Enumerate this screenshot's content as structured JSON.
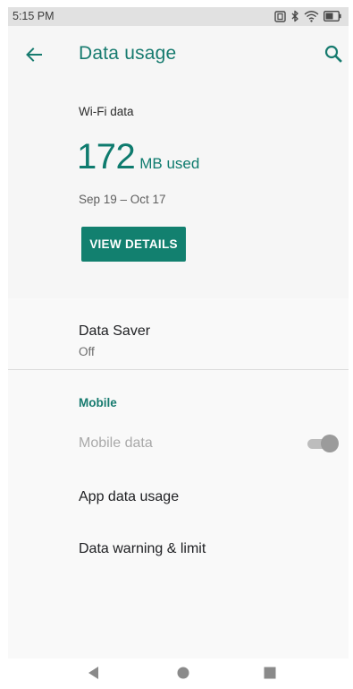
{
  "status_bar": {
    "time": "5:15 PM",
    "icons": [
      "nfc-icon",
      "bluetooth-icon",
      "wifi-icon",
      "battery-icon"
    ]
  },
  "app_bar": {
    "title": "Data usage",
    "back_icon": "arrow-back-icon",
    "search_icon": "search-icon"
  },
  "wifi": {
    "label": "Wi-Fi data",
    "amount": "172",
    "unit": "MB used",
    "date_range": "Sep 19 – Oct 17",
    "view_details_label": "VIEW DETAILS"
  },
  "data_saver": {
    "title": "Data Saver",
    "status": "Off"
  },
  "mobile": {
    "section_title": "Mobile",
    "mobile_data_label": "Mobile data",
    "mobile_data_enabled": true,
    "mobile_data_disabled": true,
    "app_data_usage_label": "App data usage",
    "data_warning_label": "Data warning & limit"
  },
  "colors": {
    "accent": "#177b6f",
    "button": "#12806f",
    "background": "#f6f6f6"
  },
  "nav_bar": {
    "buttons": [
      "back-triangle-icon",
      "home-circle-icon",
      "recents-square-icon"
    ]
  }
}
